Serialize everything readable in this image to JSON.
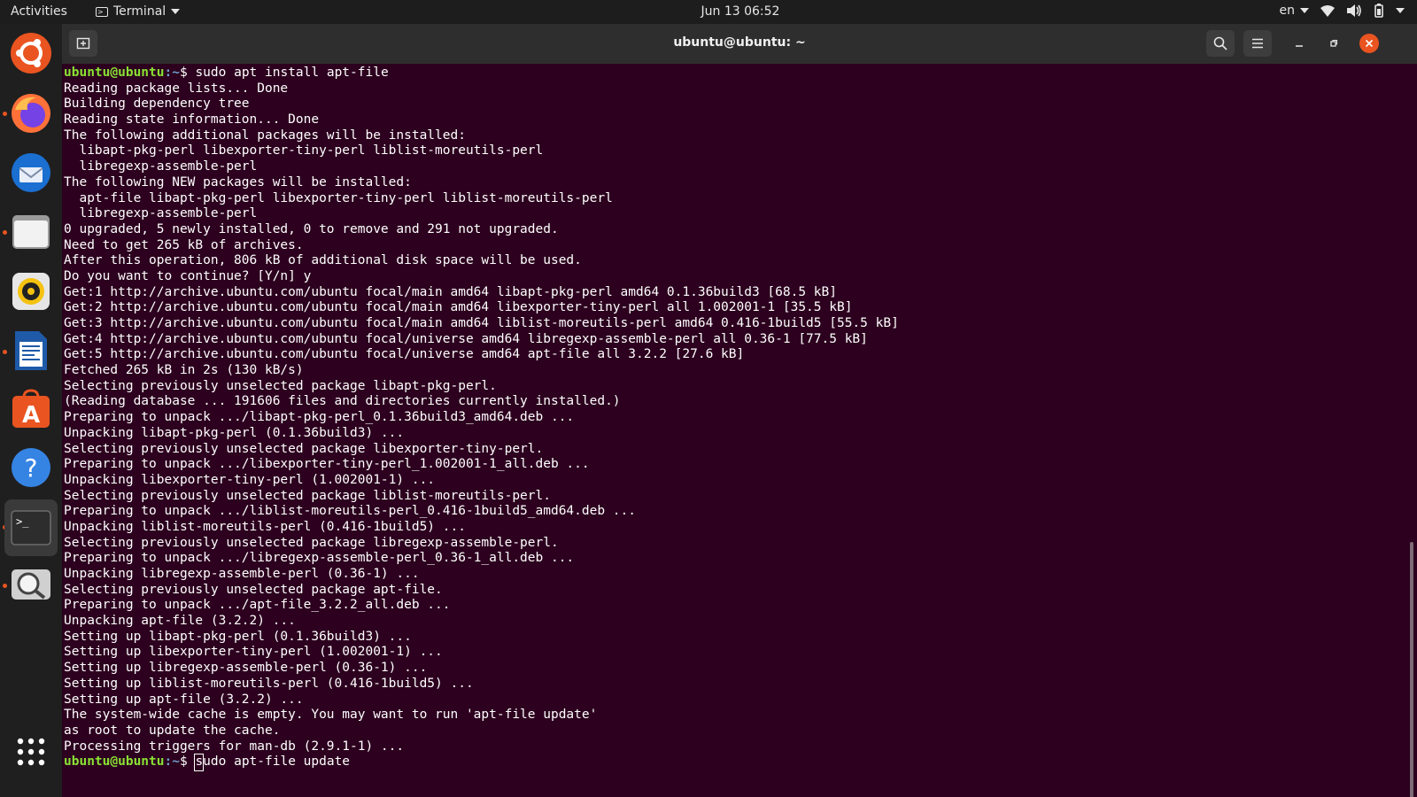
{
  "topbar": {
    "activities": "Activities",
    "app_menu": "Terminal",
    "clock": "Jun 13  06:52",
    "lang": "en"
  },
  "dock": {
    "items": [
      {
        "name": "ubuntu-software-center"
      },
      {
        "name": "firefox"
      },
      {
        "name": "thunderbird"
      },
      {
        "name": "files"
      },
      {
        "name": "rhythmbox"
      },
      {
        "name": "libreoffice-writer"
      },
      {
        "name": "app-store"
      },
      {
        "name": "help"
      },
      {
        "name": "terminal"
      },
      {
        "name": "screenshot-viewer"
      }
    ]
  },
  "window": {
    "title": "ubuntu@ubuntu: ~"
  },
  "terminal": {
    "prompt_user": "ubuntu@ubuntu",
    "prompt_path": ":~",
    "prompt_sym": "$ ",
    "first_command": "sudo apt install apt-file",
    "current_input_first_char": "s",
    "current_input_rest": "udo apt-file update",
    "output": [
      "Reading package lists... Done",
      "Building dependency tree",
      "Reading state information... Done",
      "The following additional packages will be installed:",
      "  libapt-pkg-perl libexporter-tiny-perl liblist-moreutils-perl",
      "  libregexp-assemble-perl",
      "The following NEW packages will be installed:",
      "  apt-file libapt-pkg-perl libexporter-tiny-perl liblist-moreutils-perl",
      "  libregexp-assemble-perl",
      "0 upgraded, 5 newly installed, 0 to remove and 291 not upgraded.",
      "Need to get 265 kB of archives.",
      "After this operation, 806 kB of additional disk space will be used.",
      "Do you want to continue? [Y/n] y",
      "Get:1 http://archive.ubuntu.com/ubuntu focal/main amd64 libapt-pkg-perl amd64 0.1.36build3 [68.5 kB]",
      "Get:2 http://archive.ubuntu.com/ubuntu focal/main amd64 libexporter-tiny-perl all 1.002001-1 [35.5 kB]",
      "Get:3 http://archive.ubuntu.com/ubuntu focal/main amd64 liblist-moreutils-perl amd64 0.416-1build5 [55.5 kB]",
      "Get:4 http://archive.ubuntu.com/ubuntu focal/universe amd64 libregexp-assemble-perl all 0.36-1 [77.5 kB]",
      "Get:5 http://archive.ubuntu.com/ubuntu focal/universe amd64 apt-file all 3.2.2 [27.6 kB]",
      "Fetched 265 kB in 2s (130 kB/s)",
      "Selecting previously unselected package libapt-pkg-perl.",
      "(Reading database ... 191606 files and directories currently installed.)",
      "Preparing to unpack .../libapt-pkg-perl_0.1.36build3_amd64.deb ...",
      "Unpacking libapt-pkg-perl (0.1.36build3) ...",
      "Selecting previously unselected package libexporter-tiny-perl.",
      "Preparing to unpack .../libexporter-tiny-perl_1.002001-1_all.deb ...",
      "Unpacking libexporter-tiny-perl (1.002001-1) ...",
      "Selecting previously unselected package liblist-moreutils-perl.",
      "Preparing to unpack .../liblist-moreutils-perl_0.416-1build5_amd64.deb ...",
      "Unpacking liblist-moreutils-perl (0.416-1build5) ...",
      "Selecting previously unselected package libregexp-assemble-perl.",
      "Preparing to unpack .../libregexp-assemble-perl_0.36-1_all.deb ...",
      "Unpacking libregexp-assemble-perl (0.36-1) ...",
      "Selecting previously unselected package apt-file.",
      "Preparing to unpack .../apt-file_3.2.2_all.deb ...",
      "Unpacking apt-file (3.2.2) ...",
      "Setting up libapt-pkg-perl (0.1.36build3) ...",
      "Setting up libexporter-tiny-perl (1.002001-1) ...",
      "Setting up libregexp-assemble-perl (0.36-1) ...",
      "Setting up liblist-moreutils-perl (0.416-1build5) ...",
      "Setting up apt-file (3.2.2) ...",
      "The system-wide cache is empty. You may want to run 'apt-file update'",
      "as root to update the cache.",
      "Processing triggers for man-db (2.9.1-1) ..."
    ]
  }
}
